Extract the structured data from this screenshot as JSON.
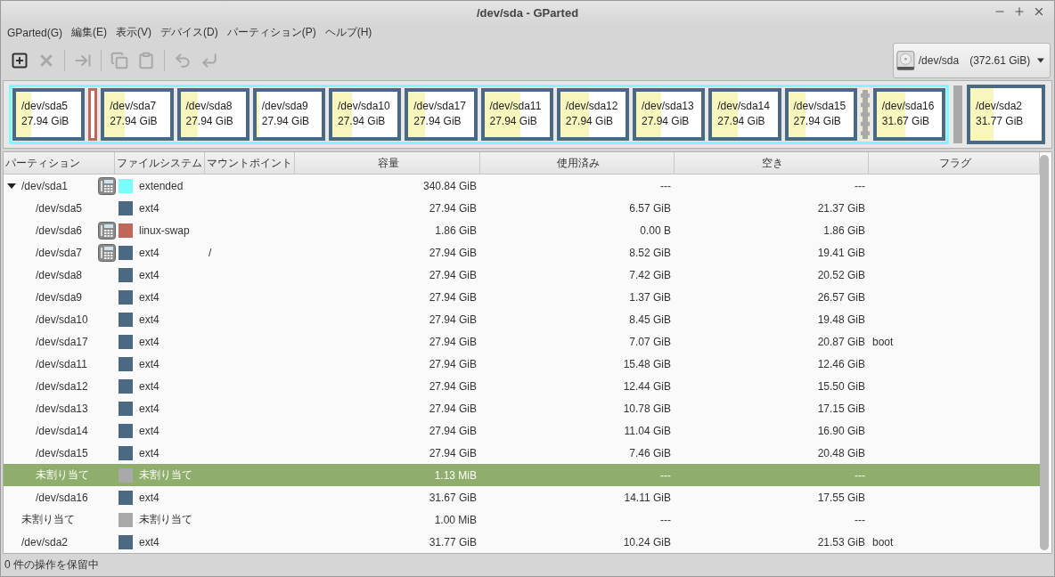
{
  "window": {
    "title": "/dev/sda - GParted"
  },
  "menu": [
    "GParted(G)",
    "編集(E)",
    "表示(V)",
    "デバイス(D)",
    "パーティション(P)",
    "ヘルプ(H)"
  ],
  "toolbar": [
    {
      "kind": "new",
      "disabled": false
    },
    {
      "kind": "delete",
      "disabled": true
    },
    {
      "kind": "separator"
    },
    {
      "kind": "resize",
      "disabled": true
    },
    {
      "kind": "separator"
    },
    {
      "kind": "copy",
      "disabled": true
    },
    {
      "kind": "paste",
      "disabled": true
    },
    {
      "kind": "separator"
    },
    {
      "kind": "undo",
      "disabled": true
    },
    {
      "kind": "apply",
      "disabled": true
    }
  ],
  "device": {
    "name": "/dev/sda",
    "size": "(372.61 GiB)"
  },
  "map": [
    {
      "kind": "extended",
      "color": "#7dfcfe",
      "children": [
        {
          "kind": "partition",
          "name": "/dev/sda5",
          "size": "27.94 GiB",
          "level": 0.235,
          "color": "#4b6983"
        },
        {
          "kind": "swap",
          "color": "#c1665a"
        },
        {
          "kind": "partition",
          "name": "/dev/sda7",
          "size": "27.94 GiB",
          "level": 0.305,
          "color": "#4b6983"
        },
        {
          "kind": "partition",
          "name": "/dev/sda8",
          "size": "27.94 GiB",
          "level": 0.266,
          "color": "#4b6983"
        },
        {
          "kind": "partition",
          "name": "/dev/sda9",
          "size": "27.94 GiB",
          "level": 0.049,
          "color": "#4b6983"
        },
        {
          "kind": "partition",
          "name": "/dev/sda10",
          "size": "27.94 GiB",
          "level": 0.302,
          "color": "#4b6983"
        },
        {
          "kind": "partition",
          "name": "/dev/sda17",
          "size": "27.94 GiB",
          "level": 0.253,
          "color": "#4b6983"
        },
        {
          "kind": "partition",
          "name": "/dev/sda11",
          "size": "27.94 GiB",
          "level": 0.554,
          "color": "#4b6983"
        },
        {
          "kind": "partition",
          "name": "/dev/sda12",
          "size": "27.94 GiB",
          "level": 0.445,
          "color": "#4b6983"
        },
        {
          "kind": "partition",
          "name": "/dev/sda13",
          "size": "27.94 GiB",
          "level": 0.386,
          "color": "#4b6983"
        },
        {
          "kind": "partition",
          "name": "/dev/sda14",
          "size": "27.94 GiB",
          "level": 0.395,
          "color": "#4b6983"
        },
        {
          "kind": "partition",
          "name": "/dev/sda15",
          "size": "27.94 GiB",
          "level": 0.267,
          "color": "#4b6983"
        },
        {
          "kind": "unallocated",
          "color": "#a9a9a9"
        },
        {
          "kind": "partition",
          "name": "/dev/sda16",
          "size": "31.67 GiB",
          "level": 0.446,
          "color": "#4b6983"
        }
      ]
    },
    {
      "kind": "gap",
      "color": "#a9a9a9"
    },
    {
      "kind": "partition",
      "name": "/dev/sda2",
      "size": "31.77 GiB",
      "level": 0.322,
      "color": "#4b6983"
    }
  ],
  "table": {
    "columns": [
      "パーティション",
      "ファイルシステム",
      "マウントポイント",
      "容量",
      "使用済み",
      "空き",
      "フラグ"
    ],
    "rows": [
      {
        "partition": "/dev/sda1",
        "locked": true,
        "color": "#7dfcfe",
        "filesystem": "extended",
        "size": "340.84 GiB",
        "used": "---",
        "free": "---",
        "selected": false,
        "expanded": true,
        "children": [
          {
            "partition": "/dev/sda5",
            "locked": false,
            "color": "#4b6983",
            "filesystem": "ext4",
            "size": "27.94 GiB",
            "used": "6.57 GiB",
            "free": "21.37 GiB",
            "selected": false
          },
          {
            "partition": "/dev/sda6",
            "locked": true,
            "color": "#c1665a",
            "filesystem": "linux-swap",
            "size": "1.86 GiB",
            "used": "0.00 B",
            "free": "1.86 GiB",
            "selected": false
          },
          {
            "partition": "/dev/sda7",
            "locked": true,
            "color": "#4b6983",
            "filesystem": "ext4",
            "mount": "/",
            "size": "27.94 GiB",
            "used": "8.52 GiB",
            "free": "19.41 GiB",
            "selected": false
          },
          {
            "partition": "/dev/sda8",
            "locked": false,
            "color": "#4b6983",
            "filesystem": "ext4",
            "size": "27.94 GiB",
            "used": "7.42 GiB",
            "free": "20.52 GiB",
            "selected": false
          },
          {
            "partition": "/dev/sda9",
            "locked": false,
            "color": "#4b6983",
            "filesystem": "ext4",
            "size": "27.94 GiB",
            "used": "1.37 GiB",
            "free": "26.57 GiB",
            "selected": false
          },
          {
            "partition": "/dev/sda10",
            "locked": false,
            "color": "#4b6983",
            "filesystem": "ext4",
            "size": "27.94 GiB",
            "used": "8.45 GiB",
            "free": "19.48 GiB",
            "selected": false
          },
          {
            "partition": "/dev/sda17",
            "locked": false,
            "color": "#4b6983",
            "filesystem": "ext4",
            "size": "27.94 GiB",
            "used": "7.07 GiB",
            "free": "20.87 GiB",
            "flags": "boot",
            "selected": false
          },
          {
            "partition": "/dev/sda11",
            "locked": false,
            "color": "#4b6983",
            "filesystem": "ext4",
            "size": "27.94 GiB",
            "used": "15.48 GiB",
            "free": "12.46 GiB",
            "selected": false
          },
          {
            "partition": "/dev/sda12",
            "locked": false,
            "color": "#4b6983",
            "filesystem": "ext4",
            "size": "27.94 GiB",
            "used": "12.44 GiB",
            "free": "15.50 GiB",
            "selected": false
          },
          {
            "partition": "/dev/sda13",
            "locked": false,
            "color": "#4b6983",
            "filesystem": "ext4",
            "size": "27.94 GiB",
            "used": "10.78 GiB",
            "free": "17.15 GiB",
            "selected": false
          },
          {
            "partition": "/dev/sda14",
            "locked": false,
            "color": "#4b6983",
            "filesystem": "ext4",
            "size": "27.94 GiB",
            "used": "11.04 GiB",
            "free": "16.90 GiB",
            "selected": false
          },
          {
            "partition": "/dev/sda15",
            "locked": false,
            "color": "#4b6983",
            "filesystem": "ext4",
            "size": "27.94 GiB",
            "used": "7.46 GiB",
            "free": "20.48 GiB",
            "selected": false
          },
          {
            "partition": "未割り当て",
            "locked": false,
            "color": "#a9a9a9",
            "filesystem": "未割り当て",
            "size": "1.13 MiB",
            "used": "---",
            "free": "---",
            "selected": true
          },
          {
            "partition": "/dev/sda16",
            "locked": false,
            "color": "#4b6983",
            "filesystem": "ext4",
            "size": "31.67 GiB",
            "used": "14.11 GiB",
            "free": "17.55 GiB",
            "selected": false
          }
        ]
      },
      {
        "partition": "未割り当て",
        "locked": false,
        "color": "#a9a9a9",
        "filesystem": "未割り当て",
        "size": "1.00 MiB",
        "used": "---",
        "free": "---",
        "selected": false
      },
      {
        "partition": "/dev/sda2",
        "locked": false,
        "color": "#4b6983",
        "filesystem": "ext4",
        "size": "31.77 GiB",
        "used": "10.24 GiB",
        "free": "21.53 GiB",
        "flags": "boot",
        "selected": false
      }
    ]
  },
  "status_bar": "0 件の操作を保留中"
}
